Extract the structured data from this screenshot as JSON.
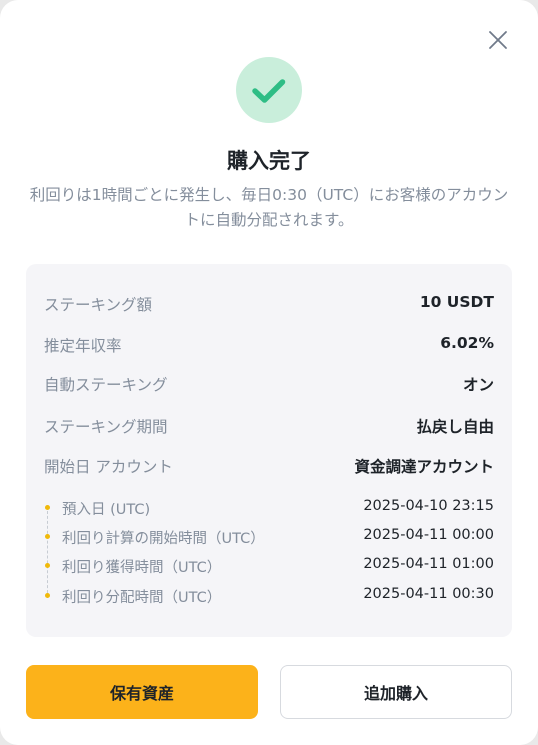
{
  "dialog": {
    "title": "購入完了",
    "message": "利回りは1時間ごとに発生し、毎日0:30（UTC）にお客様のアカウントに自動分配されます。",
    "close_icon": "close-icon",
    "status_icon": "check-circle-icon"
  },
  "details": [
    {
      "label": "ステーキング額",
      "value": "10 USDT"
    },
    {
      "label": "推定年収率",
      "value": "6.02%"
    },
    {
      "label": "自動ステーキング",
      "value": "オン"
    },
    {
      "label": "ステーキング期間",
      "value": "払戻し自由"
    },
    {
      "label": "開始日 アカウント",
      "value": "資金調達アカウント"
    }
  ],
  "timeline": [
    {
      "label": "預入日 (UTC)",
      "value": "2025-04-10 23:15"
    },
    {
      "label": "利回り計算の開始時間（UTC）",
      "value": "2025-04-11 00:00"
    },
    {
      "label": "利回り獲得時間（UTC）",
      "value": "2025-04-11 01:00"
    },
    {
      "label": "利回り分配時間（UTC）",
      "value": "2025-04-11 00:30"
    }
  ],
  "actions": {
    "primary_label": "保有資産",
    "secondary_label": "追加購入"
  },
  "colors": {
    "accent": "#fcb21a",
    "success": "#2ebd85",
    "success_bg": "#c9eedb",
    "muted_text": "#848e9c",
    "panel_bg": "#f5f5f8"
  }
}
